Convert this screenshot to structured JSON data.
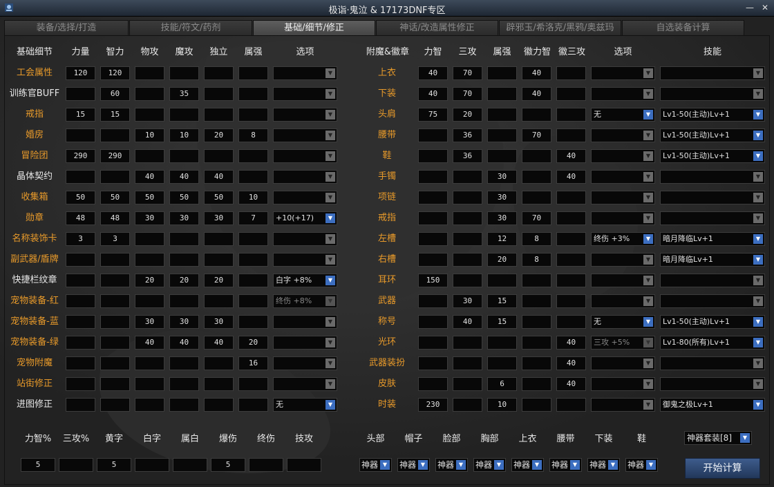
{
  "window": {
    "title": "极诣·鬼泣 & 17173DNF专区",
    "minimize": "—",
    "close": "✕"
  },
  "tabs": [
    {
      "label": "装备/选择/打造"
    },
    {
      "label": "技能/符文/药剂"
    },
    {
      "label": "基础/细节/修正",
      "active": true
    },
    {
      "label": "神话/改造属性修正"
    },
    {
      "label": "辟邪玉/希洛克/黑鸦/奥兹玛"
    },
    {
      "label": "自选装备计算"
    }
  ],
  "left": {
    "headers": [
      "基础细节",
      "力量",
      "智力",
      "物攻",
      "魔攻",
      "独立",
      "属强",
      "选项"
    ],
    "rows": [
      {
        "label": "工会属性",
        "color": "orange",
        "values": [
          "120",
          "120",
          "",
          "",
          "",
          ""
        ],
        "option": "",
        "option_style": "plain"
      },
      {
        "label": "训练官BUFF",
        "color": "white",
        "values": [
          "",
          "60",
          "",
          "35",
          "",
          ""
        ],
        "option": "",
        "option_style": "plain"
      },
      {
        "label": "戒指",
        "color": "orange",
        "values": [
          "15",
          "15",
          "",
          "",
          "",
          ""
        ],
        "option": "",
        "option_style": "plain"
      },
      {
        "label": "婚房",
        "color": "orange",
        "values": [
          "",
          "",
          "10",
          "10",
          "20",
          "8"
        ],
        "option": "",
        "option_style": "plain"
      },
      {
        "label": "冒险团",
        "color": "orange",
        "values": [
          "290",
          "290",
          "",
          "",
          "",
          ""
        ],
        "option": "",
        "option_style": "plain"
      },
      {
        "label": "晶体契约",
        "color": "white",
        "values": [
          "",
          "",
          "40",
          "40",
          "40",
          ""
        ],
        "option": "",
        "option_style": "plain"
      },
      {
        "label": "收集箱",
        "color": "orange",
        "values": [
          "50",
          "50",
          "50",
          "50",
          "50",
          "10"
        ],
        "option": "",
        "option_style": "plain"
      },
      {
        "label": "勋章",
        "color": "orange",
        "values": [
          "48",
          "48",
          "30",
          "30",
          "30",
          "7"
        ],
        "option": "+10(+17)",
        "option_style": "active"
      },
      {
        "label": "名称装饰卡",
        "color": "orange",
        "values": [
          "3",
          "3",
          "",
          "",
          "",
          ""
        ],
        "option": "",
        "option_style": "plain"
      },
      {
        "label": "副武器/盾牌",
        "color": "orange",
        "values": [
          "",
          "",
          "",
          "",
          "",
          ""
        ],
        "option": "",
        "option_style": "plain"
      },
      {
        "label": "快捷栏纹章",
        "color": "white",
        "values": [
          "",
          "",
          "20",
          "20",
          "20",
          ""
        ],
        "option": "白字 +8%",
        "option_style": "active"
      },
      {
        "label": "宠物装备-红",
        "color": "orange",
        "values": [
          "",
          "",
          "",
          "",
          "",
          ""
        ],
        "option": "终伤 +8%",
        "option_style": "disabled"
      },
      {
        "label": "宠物装备-蓝",
        "color": "orange",
        "values": [
          "",
          "",
          "30",
          "30",
          "30",
          ""
        ],
        "option": "",
        "option_style": "plain"
      },
      {
        "label": "宠物装备-绿",
        "color": "orange",
        "values": [
          "",
          "",
          "40",
          "40",
          "40",
          "20"
        ],
        "option": "",
        "option_style": "plain"
      },
      {
        "label": "宠物附魔",
        "color": "orange",
        "values": [
          "",
          "",
          "",
          "",
          "",
          "16"
        ],
        "option": "",
        "option_style": "plain"
      },
      {
        "label": "站街修正",
        "color": "orange",
        "values": [
          "",
          "",
          "",
          "",
          "",
          ""
        ],
        "option": "",
        "option_style": "plain"
      },
      {
        "label": "进图修正",
        "color": "white",
        "values": [
          "",
          "",
          "",
          "",
          "",
          ""
        ],
        "option": "无",
        "option_style": "active"
      }
    ]
  },
  "right": {
    "headers": [
      "附魔&徽章",
      "力智",
      "三攻",
      "属强",
      "徽力智",
      "徽三攻",
      "选项",
      "技能"
    ],
    "rows": [
      {
        "label": "上衣",
        "values": [
          "40",
          "70",
          "",
          "40",
          ""
        ],
        "option": "",
        "option_style": "plain",
        "skill": "",
        "skill_style": "plain"
      },
      {
        "label": "下装",
        "values": [
          "40",
          "70",
          "",
          "40",
          ""
        ],
        "option": "",
        "option_style": "plain",
        "skill": "",
        "skill_style": "plain"
      },
      {
        "label": "头肩",
        "values": [
          "75",
          "20",
          "",
          "",
          ""
        ],
        "option": "无",
        "option_style": "active",
        "skill": "Lv1-50(主动)Lv+1",
        "skill_style": "active"
      },
      {
        "label": "腰带",
        "values": [
          "",
          "36",
          "",
          "70",
          ""
        ],
        "option": "",
        "option_style": "plain",
        "skill": "Lv1-50(主动)Lv+1",
        "skill_style": "active"
      },
      {
        "label": "鞋",
        "values": [
          "",
          "36",
          "",
          "",
          "40"
        ],
        "option": "",
        "option_style": "plain",
        "skill": "Lv1-50(主动)Lv+1",
        "skill_style": "active"
      },
      {
        "label": "手镯",
        "values": [
          "",
          "",
          "30",
          "",
          "40"
        ],
        "option": "",
        "option_style": "plain",
        "skill": "",
        "skill_style": "plain"
      },
      {
        "label": "项链",
        "values": [
          "",
          "",
          "30",
          "",
          ""
        ],
        "option": "",
        "option_style": "plain",
        "skill": "",
        "skill_style": "plain"
      },
      {
        "label": "戒指",
        "values": [
          "",
          "",
          "30",
          "70",
          ""
        ],
        "option": "",
        "option_style": "plain",
        "skill": "",
        "skill_style": "plain"
      },
      {
        "label": "左槽",
        "values": [
          "",
          "",
          "12",
          "8",
          ""
        ],
        "option": "终伤 +3%",
        "option_style": "active",
        "skill": "暗月降临Lv+1",
        "skill_style": "active"
      },
      {
        "label": "右槽",
        "values": [
          "",
          "",
          "20",
          "8",
          ""
        ],
        "option": "",
        "option_style": "plain",
        "skill": "暗月降临Lv+1",
        "skill_style": "active"
      },
      {
        "label": "耳环",
        "values": [
          "150",
          "",
          "",
          "",
          ""
        ],
        "option": "",
        "option_style": "plain",
        "skill": "",
        "skill_style": "plain"
      },
      {
        "label": "武器",
        "values": [
          "",
          "30",
          "15",
          "",
          ""
        ],
        "option": "",
        "option_style": "plain",
        "skill": "",
        "skill_style": "plain"
      },
      {
        "label": "称号",
        "values": [
          "",
          "40",
          "15",
          "",
          ""
        ],
        "option": "无",
        "option_style": "active",
        "skill": "Lv1-50(主动)Lv+1",
        "skill_style": "active"
      },
      {
        "label": "光环",
        "values": [
          "",
          "",
          "",
          "",
          "40"
        ],
        "option": "三攻 +5%",
        "option_style": "disabled",
        "skill": "Lv1-80(所有)Lv+1",
        "skill_style": "active"
      },
      {
        "label": "武器装扮",
        "values": [
          "",
          "",
          "",
          "",
          "40"
        ],
        "option": "",
        "option_style": "plain",
        "skill": "",
        "skill_style": "plain"
      },
      {
        "label": "皮肤",
        "values": [
          "",
          "",
          "6",
          "",
          "40"
        ],
        "option": "",
        "option_style": "plain",
        "skill": "",
        "skill_style": "plain"
      },
      {
        "label": "时装",
        "values": [
          "230",
          "",
          "10",
          "",
          ""
        ],
        "option": "",
        "option_style": "plain",
        "skill": "御鬼之极Lv+1",
        "skill_style": "active"
      }
    ]
  },
  "bottom": {
    "headers": [
      "力智%",
      "三攻%",
      "黄字",
      "白字",
      "属白",
      "爆伤",
      "终伤",
      "技攻"
    ],
    "values": [
      "5",
      "",
      "5",
      "",
      "",
      "5",
      "",
      ""
    ],
    "slots": [
      "头部",
      "帽子",
      "脸部",
      "胸部",
      "上衣",
      "腰带",
      "下装",
      "鞋"
    ],
    "slot_values": [
      "神器",
      "神器",
      "神器",
      "神器",
      "神器",
      "神器",
      "神器",
      "神器"
    ],
    "set_select": "神器套装[8]",
    "calc_button": "开始计算"
  }
}
